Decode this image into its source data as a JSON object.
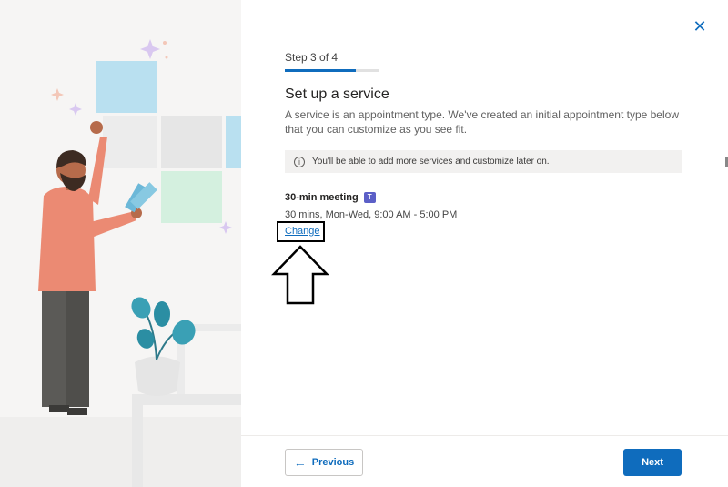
{
  "dialog": {
    "step_label": "Step 3 of 4",
    "progress": 0.75,
    "title": "Set up a service",
    "description": "A service is an appointment type. We've created an initial appointment type below that you can customize as you see fit.",
    "info_text": "You'll be able to add more services and customize later on.",
    "close_icon": "close-icon"
  },
  "service": {
    "name": "30-min meeting",
    "detail": "30 mins, Mon-Wed, 9:00 AM - 5:00 PM",
    "change_label": "Change",
    "icon": "teams-icon"
  },
  "footer": {
    "previous_label": "Previous",
    "next_label": "Next"
  },
  "colors": {
    "accent": "#0f6cbd",
    "info_bg": "#f2f1f0"
  }
}
